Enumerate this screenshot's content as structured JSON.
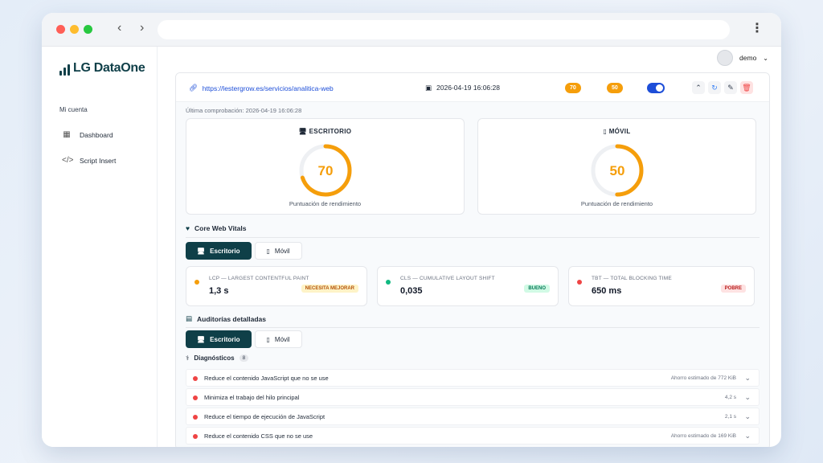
{
  "browser": {
    "url": ""
  },
  "sidebar": {
    "logo": "LG DataOne",
    "section_label": "Mi cuenta",
    "items": [
      {
        "label": "Dashboard",
        "icon": "grid-icon"
      },
      {
        "label": "Script Insert",
        "icon": "code-icon"
      }
    ]
  },
  "header": {
    "user": "demo"
  },
  "site": {
    "url": "https://lestergrow.es/servicios/analitica-web",
    "datetime": "2026-04-19 16:06:28",
    "desktop_pill": "70",
    "mobile_pill": "50",
    "last_check": "Última comprobación: 2026-04-19 16:06:28"
  },
  "scores": {
    "desktop": {
      "title": "ESCRITORIO",
      "value": "70",
      "percent": 70,
      "caption": "Puntuación de rendimiento"
    },
    "mobile": {
      "title": "MÓVIL",
      "value": "50",
      "percent": 50,
      "caption": "Puntuación de rendimiento"
    }
  },
  "cwv": {
    "title": "Core Web Vitals",
    "tabs": [
      "Escritorio",
      "Móvil"
    ],
    "metrics": [
      {
        "name": "LCP — LARGEST CONTENTFUL PAINT",
        "value": "1,3 s",
        "badge": "NECESITA MEJORAR",
        "color": "#f59e0b"
      },
      {
        "name": "CLS — CUMULATIVE LAYOUT SHIFT",
        "value": "0,035",
        "badge": "BUENO",
        "color": "#10b981"
      },
      {
        "name": "TBT — TOTAL BLOCKING TIME",
        "value": "650 ms",
        "badge": "POBRE",
        "color": "#ef4444"
      }
    ]
  },
  "audits": {
    "title": "Auditorías detalladas",
    "tabs": [
      "Escritorio",
      "Móvil"
    ],
    "diag_title": "Diagnósticos",
    "diag_count": "8",
    "rows": [
      {
        "text": "Reduce el contenido JavaScript que no se use",
        "meta": "Ahorro estimado de 772 KiB"
      },
      {
        "text": "Minimiza el trabajo del hilo principal",
        "meta": "4,2 s"
      },
      {
        "text": "Reduce el tiempo de ejecución de JavaScript",
        "meta": "2,1 s"
      },
      {
        "text": "Reduce el contenido CSS que no se use",
        "meta": "Ahorro estimado de 169 KiB"
      }
    ]
  },
  "colors": {
    "accent": "#0f3f48",
    "link": "#1d4ed8",
    "orange": "#f59e0b"
  }
}
